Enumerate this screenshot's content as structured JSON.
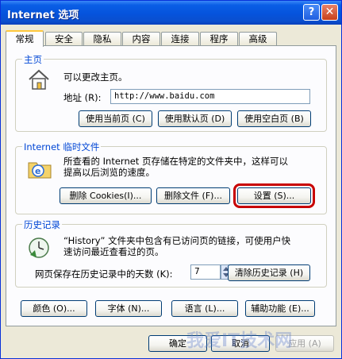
{
  "window": {
    "title": "Internet 选项",
    "help_button": "?",
    "close_button": "✕"
  },
  "tabs": [
    {
      "label": "常规",
      "active": true
    },
    {
      "label": "安全"
    },
    {
      "label": "隐私"
    },
    {
      "label": "内容"
    },
    {
      "label": "连接"
    },
    {
      "label": "程序"
    },
    {
      "label": "高级"
    }
  ],
  "homepage": {
    "legend": "主页",
    "description": "可以更改主页。",
    "address_label": "地址 (R):",
    "address_value": "http://www.baidu.com",
    "use_current": "使用当前页 (C)",
    "use_default": "使用默认页 (D)",
    "use_blank": "使用空白页 (B)"
  },
  "temp_files": {
    "legend": "Internet 临时文件",
    "description_line1": "所查看的 Internet 页存储在特定的文件夹中，这样可以",
    "description_line2": "提高以后浏览的速度。",
    "delete_cookies": "删除 Cookies(I)...",
    "delete_files": "删除文件 (F)...",
    "settings": "设置 (S)..."
  },
  "history": {
    "legend": "历史记录",
    "description_line1": "“History” 文件夹中包含有已访问页的链接，可使用户快",
    "description_line2": "速访问最近查看过的页。",
    "days_label": "网页保存在历史记录中的天数 (K):",
    "days_value": "7",
    "clear_history": "清除历史记录 (H)"
  },
  "bottom_buttons": {
    "colors": "颜色 (O)...",
    "fonts": "字体 (N)...",
    "languages": "语言 (L)...",
    "accessibility": "辅助功能 (E)..."
  },
  "dialog_buttons": {
    "ok": "确定",
    "cancel": "取消",
    "apply": "应用 (A)"
  },
  "watermark": "我爱IT技术网"
}
